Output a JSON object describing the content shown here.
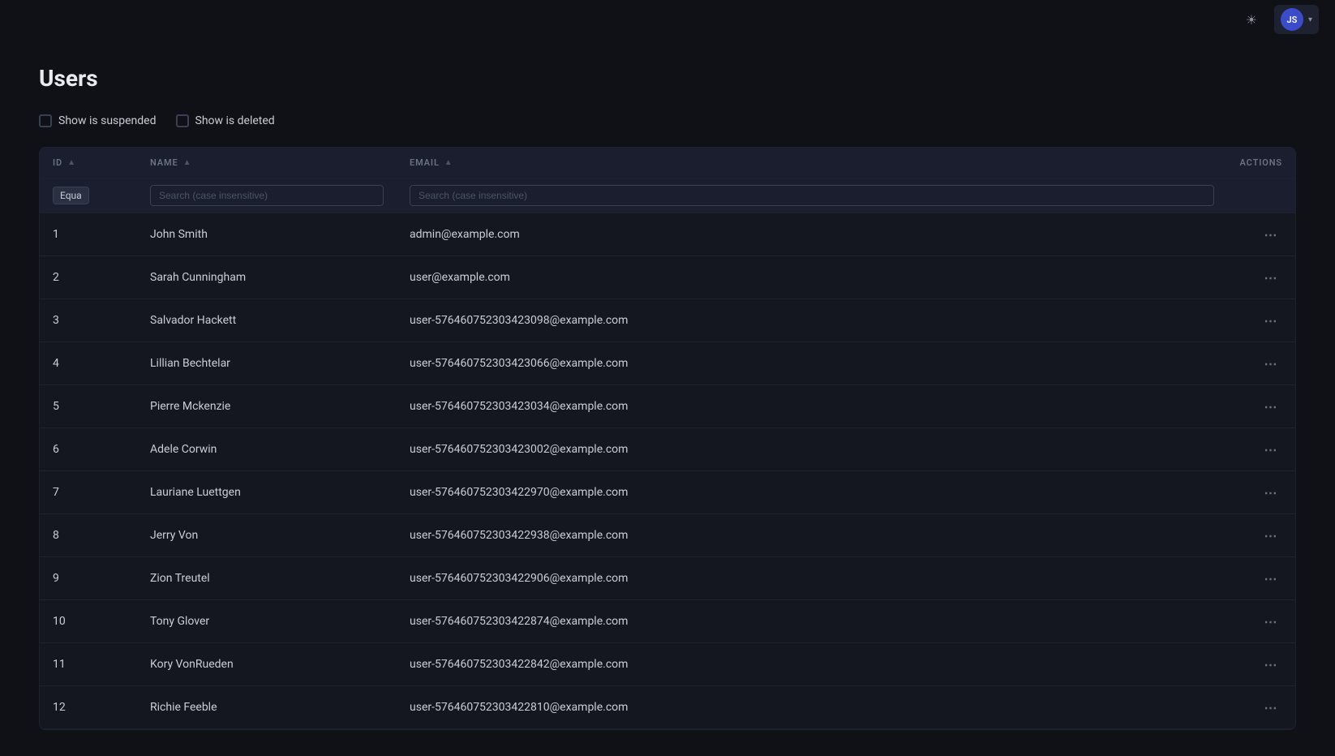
{
  "topbar": {
    "theme_icon": "☀",
    "user_initials": "JS",
    "chevron": "▾"
  },
  "page": {
    "title": "Users"
  },
  "filters": {
    "show_suspended_label": "Show is suspended",
    "show_deleted_label": "Show is deleted"
  },
  "table": {
    "columns": {
      "id": "ID",
      "name": "NAME",
      "email": "EMAIL",
      "actions": "ACTIONS"
    },
    "id_filter_badge": "Equa",
    "name_search_placeholder": "Search (case insensitive)",
    "email_search_placeholder": "Search (case insensitive)",
    "rows": [
      {
        "id": "1",
        "name": "John Smith",
        "email": "admin@example.com"
      },
      {
        "id": "2",
        "name": "Sarah Cunningham",
        "email": "user@example.com"
      },
      {
        "id": "3",
        "name": "Salvador Hackett",
        "email": "user-576460752303423098@example.com"
      },
      {
        "id": "4",
        "name": "Lillian Bechtelar",
        "email": "user-576460752303423066@example.com"
      },
      {
        "id": "5",
        "name": "Pierre Mckenzie",
        "email": "user-576460752303423034@example.com"
      },
      {
        "id": "6",
        "name": "Adele Corwin",
        "email": "user-576460752303423002@example.com"
      },
      {
        "id": "7",
        "name": "Lauriane Luettgen",
        "email": "user-576460752303422970@example.com"
      },
      {
        "id": "8",
        "name": "Jerry Von",
        "email": "user-576460752303422938@example.com"
      },
      {
        "id": "9",
        "name": "Zion Treutel",
        "email": "user-576460752303422906@example.com"
      },
      {
        "id": "10",
        "name": "Tony Glover",
        "email": "user-576460752303422874@example.com"
      },
      {
        "id": "11",
        "name": "Kory VonRueden",
        "email": "user-576460752303422842@example.com"
      },
      {
        "id": "12",
        "name": "Richie Feeble",
        "email": "user-576460752303422810@example.com"
      }
    ]
  }
}
